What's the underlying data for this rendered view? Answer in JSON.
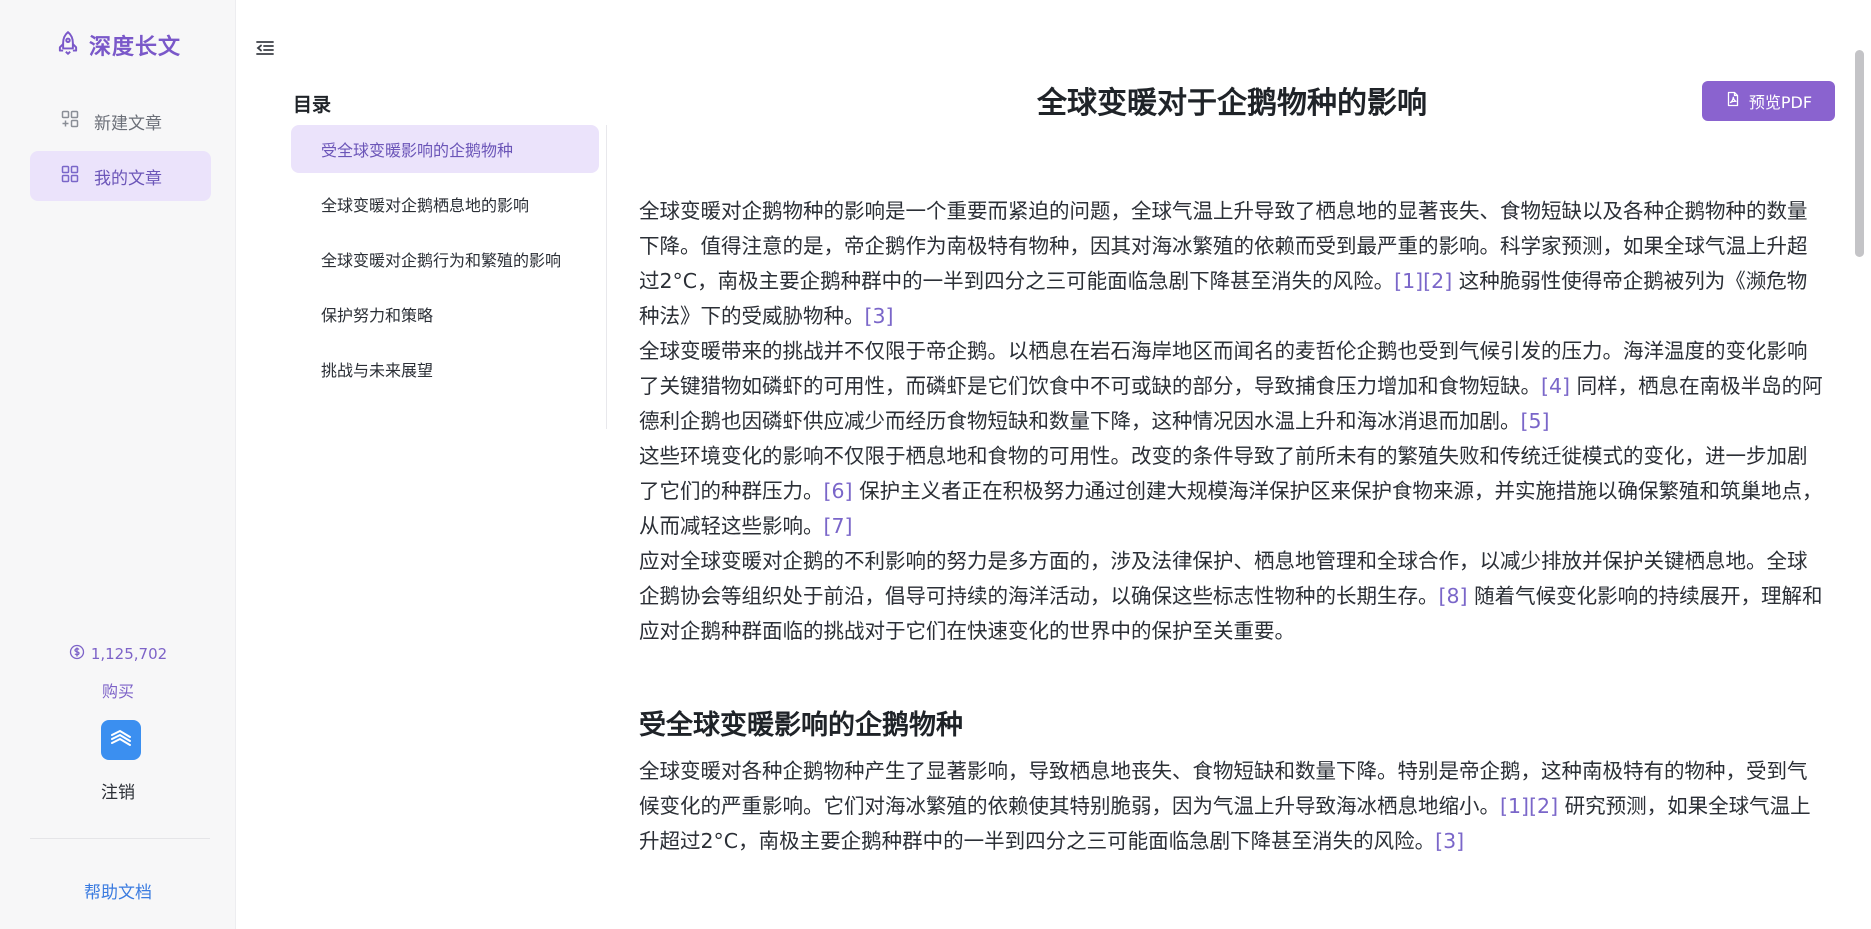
{
  "sidebar": {
    "brand": "深度长文",
    "nav": [
      {
        "label": "新建文章",
        "icon": "new-doc-icon",
        "active": false
      },
      {
        "label": "我的文章",
        "icon": "grid-icon",
        "active": true
      }
    ],
    "credits": "1,125,702",
    "buy_label": "购买",
    "logout_label": "注销",
    "help_label": "帮助文档"
  },
  "toc": {
    "title": "目录",
    "items": [
      {
        "label": "受全球变暖影响的企鹅物种",
        "active": true
      },
      {
        "label": "全球变暖对企鹅栖息地的影响",
        "active": false
      },
      {
        "label": "全球变暖对企鹅行为和繁殖的影响",
        "active": false
      },
      {
        "label": "保护努力和策略",
        "active": false
      },
      {
        "label": "挑战与未来展望",
        "active": false
      }
    ]
  },
  "toolbar": {
    "pdf_label": "预览PDF"
  },
  "article": {
    "title": "全球变暖对于企鹅物种的影响",
    "intro": [
      [
        {
          "t": "全球变暖对企鹅物种的影响是一个重要而紧迫的问题，全球气温上升导致了栖息地的显著丧失、食物短缺以及各种企鹅物种的数量下降。值得注意的是，帝企鹅作为南极特有物种，因其对海冰繁殖的依赖而受到最严重的影响。科学家预测，如果全球气温上升超过2°C，南极主要企鹅种群中的一半到四分之三可能面临急剧下降甚至消失的风险。"
        },
        {
          "c": "[1]"
        },
        {
          "c": "[2]"
        },
        {
          "t": " 这种脆弱性使得帝企鹅被列为《濒危物种法》下的受威胁物种。"
        },
        {
          "c": "[3]"
        }
      ],
      [
        {
          "t": "全球变暖带来的挑战并不仅限于帝企鹅。以栖息在岩石海岸地区而闻名的麦哲伦企鹅也受到气候引发的压力。海洋温度的变化影响了关键猎物如磷虾的可用性，而磷虾是它们饮食中不可或缺的部分，导致捕食压力增加和食物短缺。"
        },
        {
          "c": "[4]"
        },
        {
          "t": " 同样，栖息在南极半岛的阿德利企鹅也因磷虾供应减少而经历食物短缺和数量下降，这种情况因水温上升和海冰消退而加剧。"
        },
        {
          "c": "[5]"
        }
      ],
      [
        {
          "t": "这些环境变化的影响不仅限于栖息地和食物的可用性。改变的条件导致了前所未有的繁殖失败和传统迁徙模式的变化，进一步加剧了它们的种群压力。"
        },
        {
          "c": "[6]"
        },
        {
          "t": " 保护主义者正在积极努力通过创建大规模海洋保护区来保护食物来源，并实施措施以确保繁殖和筑巢地点，从而减轻这些影响。"
        },
        {
          "c": "[7]"
        }
      ],
      [
        {
          "t": "应对全球变暖对企鹅的不利影响的努力是多方面的，涉及法律保护、栖息地管理和全球合作，以减少排放并保护关键栖息地。全球企鹅协会等组织处于前沿，倡导可持续的海洋活动，以确保这些标志性物种的长期生存。"
        },
        {
          "c": "[8]"
        },
        {
          "t": " 随着气候变化影响的持续展开，理解和应对企鹅种群面临的挑战对于它们在快速变化的世界中的保护至关重要。"
        }
      ]
    ],
    "section_title": "受全球变暖影响的企鹅物种",
    "section_paras": [
      [
        {
          "t": "全球变暖对各种企鹅物种产生了显著影响，导致栖息地丧失、食物短缺和数量下降。特别是帝企鹅，这种南极特有的物种，受到气候变化的严重影响。它们对海冰繁殖的依赖使其特别脆弱，因为气温上升导致海冰栖息地缩小。"
        },
        {
          "c": "[1]"
        },
        {
          "c": "[2]"
        },
        {
          "t": " 研究预测，如果全球气温上升超过2°C，南极主要企鹅种群中的一半到四分之三可能面临急剧下降甚至消失的风险。"
        },
        {
          "c": "[3]"
        }
      ]
    ]
  }
}
